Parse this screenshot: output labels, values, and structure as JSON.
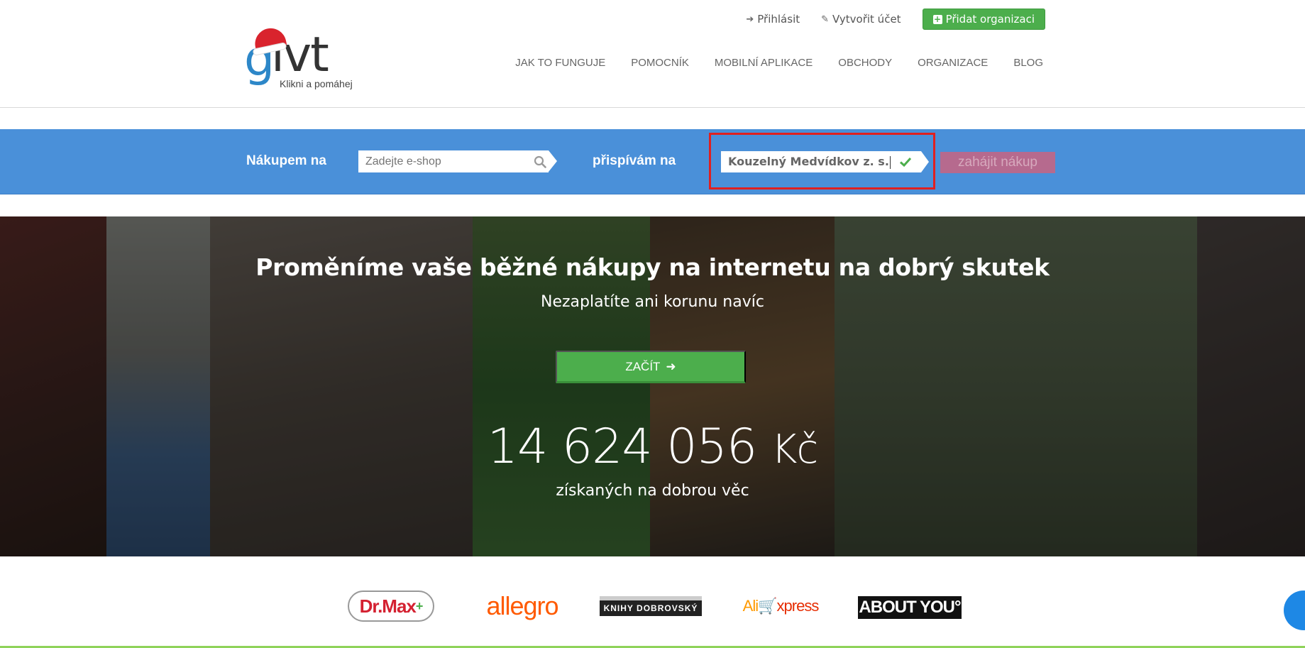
{
  "header": {
    "login_label": "Přihlásit",
    "register_label": "Vytvořit účet",
    "add_org_label": "Přidat organizaci",
    "logo_text": "givt",
    "logo_tagline": "Klikni a pomáhej",
    "nav": [
      "JAK TO FUNGUJE",
      "POMOCNÍK",
      "MOBILNÍ APLIKACE",
      "OBCHODY",
      "ORGANIZACE",
      "BLOG"
    ]
  },
  "search": {
    "shop_label": "Nákupem na",
    "shop_placeholder": "Zadejte e-shop",
    "org_label": "přispívám na",
    "org_value": "Kouzelný Medvídkov z. s.",
    "start_label": "zahájit nákup"
  },
  "hero": {
    "title": "Proměníme vaše běžné nákupy na internetu na dobrý skutek",
    "subtitle": "Nezaplatíte ani korunu navíc",
    "cta_label": "ZAČÍT",
    "amount": "14 624 056",
    "currency": "Kč",
    "amount_caption": "získaných na dobrou věc"
  },
  "shops": {
    "drmax": "Dr.Max",
    "allegro": "allegro",
    "knihy": "KNIHY DOBROVSKÝ",
    "aliexpress_a": "Ali",
    "aliexpress_b": "xpress",
    "aboutyou": "ABOUT YOU°"
  },
  "colors": {
    "band": "#4a90d9",
    "green": "#4cae4c",
    "highlight": "#e02020"
  }
}
